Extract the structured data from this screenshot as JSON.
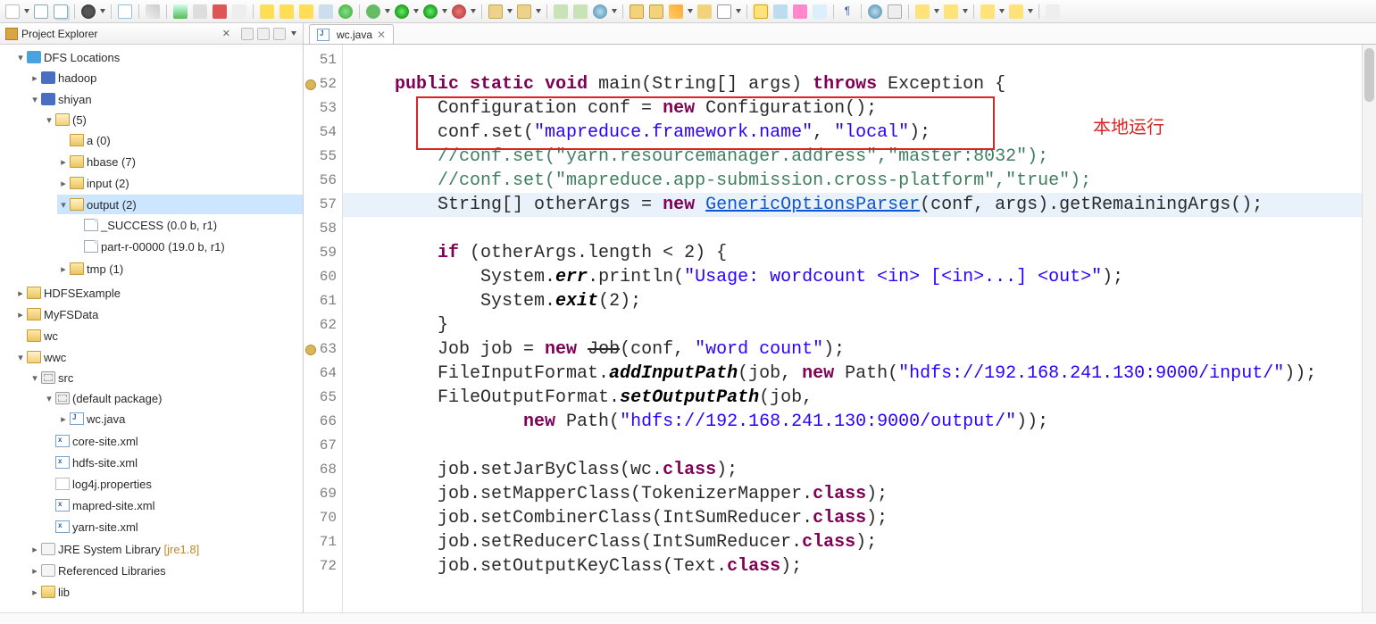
{
  "projectExplorer": {
    "title": "Project Explorer",
    "tree": {
      "dfs": {
        "label": "DFS Locations",
        "hadoop": "hadoop",
        "shiyan": "shiyan",
        "n5": "(5)",
        "a0": "a (0)",
        "hbase": "hbase (7)",
        "input": "input (2)",
        "output": "output (2)",
        "success": "_SUCCESS (0.0 b, r1)",
        "part": "part-r-00000 (19.0 b, r1)",
        "tmp": "tmp (1)"
      },
      "hdfsExample": "HDFSExample",
      "myFsData": "MyFSData",
      "wc": "wc",
      "wwc": {
        "label": "wwc",
        "src": "src",
        "pkg": "(default package)",
        "wcjava": "wc.java",
        "coreSite": "core-site.xml",
        "hdfsSite": "hdfs-site.xml",
        "log4j": "log4j.properties",
        "mapredSite": "mapred-site.xml",
        "yarnSite": "yarn-site.xml",
        "jre": "JRE System Library ",
        "jreVer": "[jre1.8]",
        "refLib": "Referenced Libraries",
        "lib": "lib"
      }
    }
  },
  "editor": {
    "tabLabel": "wc.java",
    "annotation": "本地运行",
    "lines": {
      "from": 51,
      "to": 72
    }
  },
  "code": {
    "l52": {
      "kw1": "public",
      "kw2": "static",
      "kw3": "void",
      "fn": " main(String[] args) ",
      "kw4": "throws",
      "r": " Exception {"
    },
    "l53": {
      "a": "        Configuration conf = ",
      "kw": "new",
      "b": " Configuration();"
    },
    "l54": {
      "a": "        conf.set(",
      "s1": "\"mapreduce.framework.name\"",
      "b": ", ",
      "s2": "\"local\"",
      "c": ");"
    },
    "l55": "        //conf.set(\"yarn.resourcemanager.address\",\"master:8032\");",
    "l56": "        //conf.set(\"mapreduce.app-submission.cross-platform\",\"true\");",
    "l57": {
      "a": "        String[] otherArgs = ",
      "kw": "new",
      "sp": " ",
      "lnk": "GenericOptionsParser",
      "b": "(conf, args).getRemainingArgs();"
    },
    "l59": {
      "kw": "if",
      "a": " (otherArgs.length < 2) {"
    },
    "l60": {
      "a": "            System.",
      "sty": "err",
      "b": ".println(",
      "s": "\"Usage: wordcount <in> [<in>...] <out>\"",
      "c": ");"
    },
    "l61": {
      "a": "            System.",
      "sty": "exit",
      "b": "(2);"
    },
    "l62": "        }",
    "l63": {
      "a": "        Job job = ",
      "kw": "new",
      "sp": " ",
      "strk": "Job",
      "b": "(conf, ",
      "s": "\"word count\"",
      "c": ");"
    },
    "l64": {
      "a": "        FileInputFormat.",
      "sty": "addInputPath",
      "b": "(job, ",
      "kw": "new",
      "c": " Path(",
      "s": "\"hdfs://192.168.241.130:9000/input/\"",
      "d": "));"
    },
    "l65": {
      "a": "        FileOutputFormat.",
      "sty": "setOutputPath",
      "b": "(job,"
    },
    "l66": {
      "a": "                ",
      "kw": "new",
      "b": " Path(",
      "s": "\"hdfs://192.168.241.130:9000/output/\"",
      "c": "));"
    },
    "l68": {
      "a": "        job.setJarByClass(wc.",
      "kw": "class",
      "b": ");"
    },
    "l69": {
      "a": "        job.setMapperClass(TokenizerMapper.",
      "kw": "class",
      "b": ");"
    },
    "l70": {
      "a": "        job.setCombinerClass(IntSumReducer.",
      "kw": "class",
      "b": ");"
    },
    "l71": {
      "a": "        job.setReducerClass(IntSumReducer.",
      "kw": "class",
      "b": ");"
    },
    "l72": {
      "a": "        job.setOutputKeyClass(Text.",
      "kw": "class",
      "b": ");"
    }
  }
}
